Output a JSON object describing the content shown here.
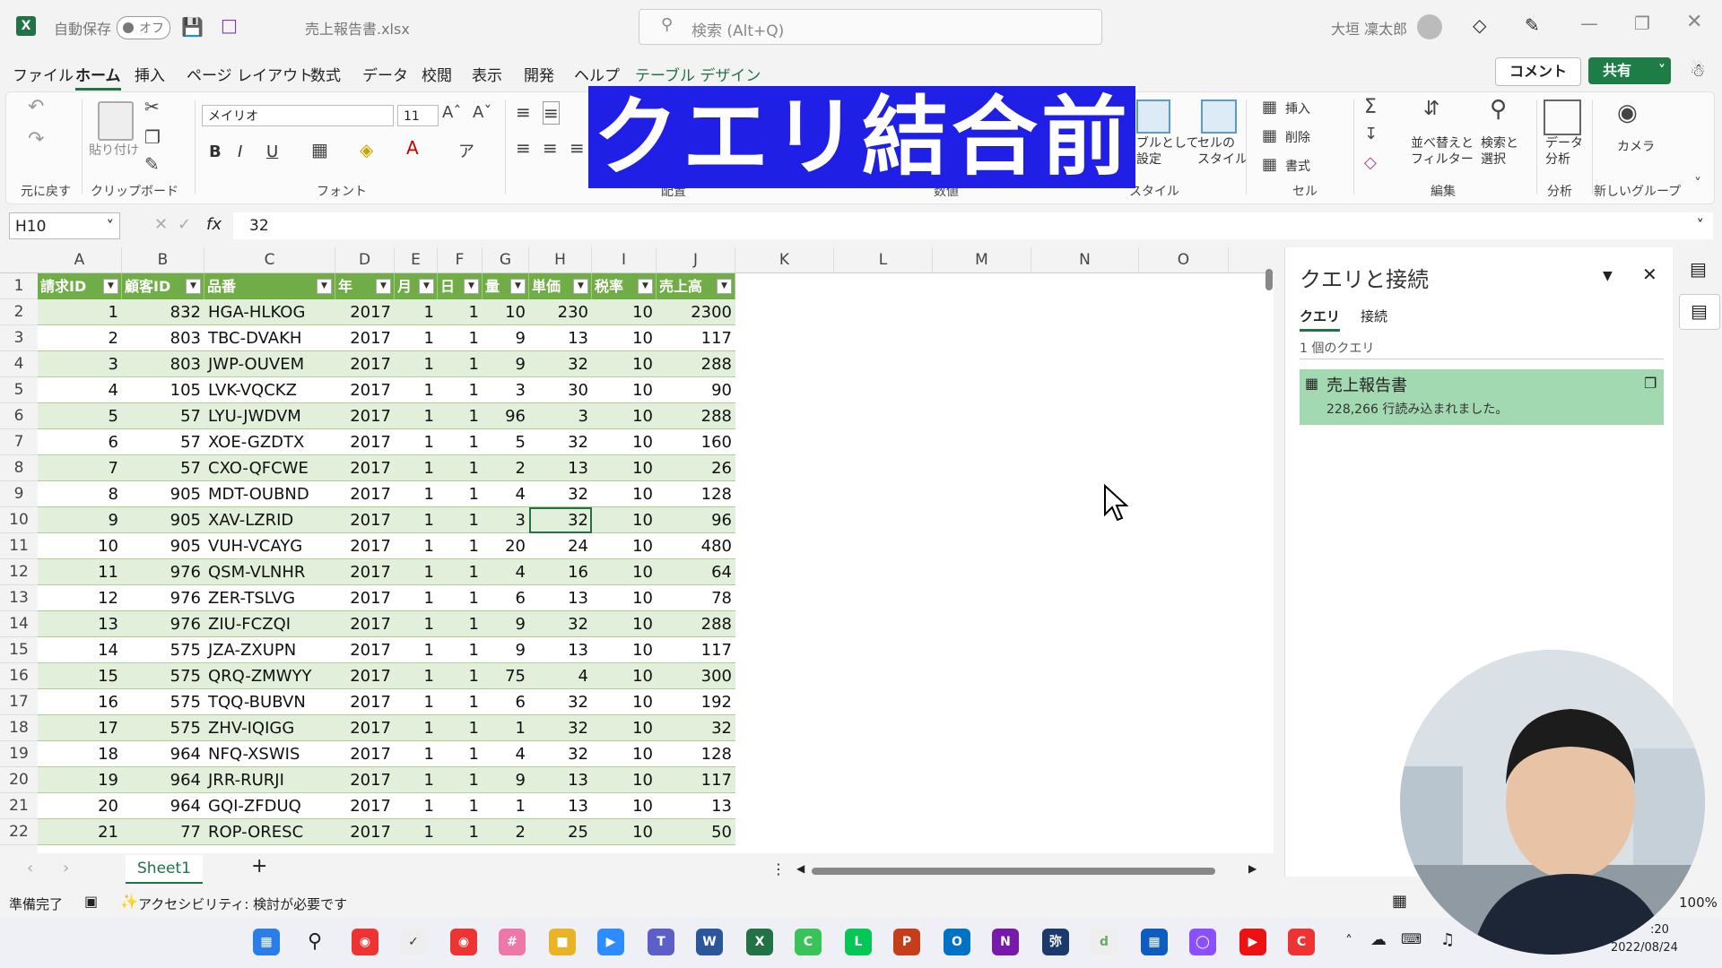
{
  "title_bar": {
    "autosave_label": "自動保存",
    "autosave_state": "オフ",
    "filename": "売上報告書.xlsx",
    "search_placeholder": "検索 (Alt+Q)",
    "user_name": "大垣 凜太郎"
  },
  "menu": [
    "ファイル",
    "ホーム",
    "挿入",
    "ページ レイアウト",
    "数式",
    "データ",
    "校閲",
    "表示",
    "開発",
    "ヘルプ",
    "テーブル デザイン"
  ],
  "menu_active": "ホーム",
  "buttons": {
    "comment": "コメント",
    "share": "共有"
  },
  "ribbon": {
    "undo_group": "元に戻す",
    "paste": "貼り付け",
    "clipboard_group": "クリップボード",
    "font_name": "メイリオ",
    "font_size": "11",
    "font_group": "フォント",
    "bold": "B",
    "italic": "I",
    "underline": "U",
    "align_group": "配置",
    "number_group": "数値",
    "table_format": "ブルとして\n設定",
    "cell_style": "セルの\nスタイル",
    "style_group": "スタイル",
    "insert": "挿入",
    "delete": "削除",
    "format": "書式",
    "cell_group": "セル",
    "sort_filter": "並べ替えと\nフィルター",
    "find_select": "検索と\n選択",
    "edit_group": "編集",
    "data_analysis": "データ\n分析",
    "analysis_group": "分析",
    "camera": "カメラ",
    "new_group": "新しいグループ"
  },
  "overlay_banner": "クエリ結合前",
  "formula_bar": {
    "name_box": "H10",
    "fx": "fx",
    "value": "32"
  },
  "columns": [
    "A",
    "B",
    "C",
    "D",
    "E",
    "F",
    "G",
    "H",
    "I",
    "J",
    "K",
    "L",
    "M",
    "N",
    "O"
  ],
  "table": {
    "headers": [
      "請求ID",
      "顧客ID",
      "品番",
      "年",
      "月",
      "日",
      "量",
      "単価",
      "税率",
      "売上高"
    ],
    "rows": [
      [
        "1",
        "832",
        "HGA-HLKOG",
        "2017",
        "1",
        "1",
        "10",
        "230",
        "10",
        "2300"
      ],
      [
        "2",
        "803",
        "TBC-DVAKH",
        "2017",
        "1",
        "1",
        "9",
        "13",
        "10",
        "117"
      ],
      [
        "3",
        "803",
        "JWP-OUVEM",
        "2017",
        "1",
        "1",
        "9",
        "32",
        "10",
        "288"
      ],
      [
        "4",
        "105",
        "LVK-VQCKZ",
        "2017",
        "1",
        "1",
        "3",
        "30",
        "10",
        "90"
      ],
      [
        "5",
        "57",
        "LYU-JWDVM",
        "2017",
        "1",
        "1",
        "96",
        "3",
        "10",
        "288"
      ],
      [
        "6",
        "57",
        "XOE-GZDTX",
        "2017",
        "1",
        "1",
        "5",
        "32",
        "10",
        "160"
      ],
      [
        "7",
        "57",
        "CXO-QFCWE",
        "2017",
        "1",
        "1",
        "2",
        "13",
        "10",
        "26"
      ],
      [
        "8",
        "905",
        "MDT-OUBND",
        "2017",
        "1",
        "1",
        "4",
        "32",
        "10",
        "128"
      ],
      [
        "9",
        "905",
        "XAV-LZRID",
        "2017",
        "1",
        "1",
        "3",
        "32",
        "10",
        "96"
      ],
      [
        "10",
        "905",
        "VUH-VCAYG",
        "2017",
        "1",
        "1",
        "20",
        "24",
        "10",
        "480"
      ],
      [
        "11",
        "976",
        "QSM-VLNHR",
        "2017",
        "1",
        "1",
        "4",
        "16",
        "10",
        "64"
      ],
      [
        "12",
        "976",
        "ZER-TSLVG",
        "2017",
        "1",
        "1",
        "6",
        "13",
        "10",
        "78"
      ],
      [
        "13",
        "976",
        "ZIU-FCZQI",
        "2017",
        "1",
        "1",
        "9",
        "32",
        "10",
        "288"
      ],
      [
        "14",
        "575",
        "JZA-ZXUPN",
        "2017",
        "1",
        "1",
        "9",
        "13",
        "10",
        "117"
      ],
      [
        "15",
        "575",
        "QRQ-ZMWYY",
        "2017",
        "1",
        "1",
        "75",
        "4",
        "10",
        "300"
      ],
      [
        "16",
        "575",
        "TQQ-BUBVN",
        "2017",
        "1",
        "1",
        "6",
        "32",
        "10",
        "192"
      ],
      [
        "17",
        "575",
        "ZHV-IQIGG",
        "2017",
        "1",
        "1",
        "1",
        "32",
        "10",
        "32"
      ],
      [
        "18",
        "964",
        "NFQ-XSWIS",
        "2017",
        "1",
        "1",
        "4",
        "32",
        "10",
        "128"
      ],
      [
        "19",
        "964",
        "JRR-RURJI",
        "2017",
        "1",
        "1",
        "9",
        "13",
        "10",
        "117"
      ],
      [
        "20",
        "964",
        "GQI-ZFDUQ",
        "2017",
        "1",
        "1",
        "1",
        "13",
        "10",
        "13"
      ],
      [
        "21",
        "77",
        "ROP-ORESC",
        "2017",
        "1",
        "1",
        "2",
        "25",
        "10",
        "50"
      ]
    ]
  },
  "row_numbers": [
    "1",
    "2",
    "3",
    "4",
    "5",
    "6",
    "7",
    "8",
    "9",
    "10",
    "11",
    "12",
    "13",
    "14",
    "15",
    "16",
    "17",
    "18",
    "19",
    "20",
    "21",
    "22"
  ],
  "sheet_tab": "Sheet1",
  "panel": {
    "title": "クエリと接続",
    "tab_queries": "クエリ",
    "tab_connections": "接続",
    "query_count": "1 個のクエリ",
    "query_name": "売上報告書",
    "query_status": "228,266 行読み込まれました。"
  },
  "status_bar": {
    "ready": "準備完了",
    "accessibility": "アクセシビリティ: 検討が必要です",
    "zoom": "100%"
  },
  "taskbar": {
    "time": ":20",
    "date": "2022/08/24"
  },
  "colors": {
    "excel_green": "#217346",
    "table_header": "#70ad47",
    "band": "#e2efda",
    "banner": "#1f1fe6",
    "query_card": "#a3d9b1"
  }
}
